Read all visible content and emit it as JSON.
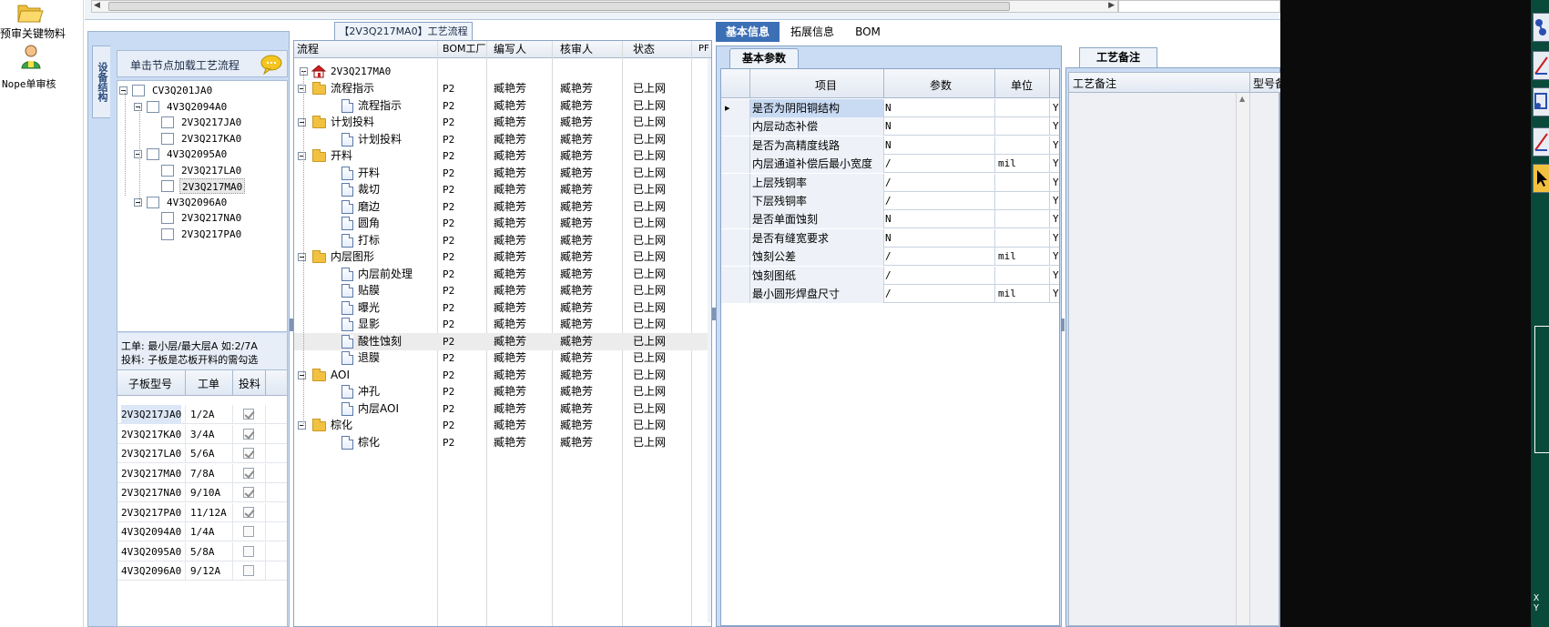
{
  "launcher": {
    "items": [
      {
        "icon": "folder-open-icon",
        "label": "预审关键物料"
      },
      {
        "icon": "user-review-icon",
        "label": "Nope单审核"
      }
    ]
  },
  "flow_title_tab": "【2V3Q217MA0】工艺流程",
  "left_panel": {
    "side_tab": "设备结构",
    "load_hint": "单击节点加载工艺流程",
    "tree": [
      {
        "label": "CV3Q201JA0",
        "level": 0,
        "expanded": true
      },
      {
        "label": "4V3Q2094A0",
        "level": 1,
        "expanded": true
      },
      {
        "label": "2V3Q217JA0",
        "level": 2
      },
      {
        "label": "2V3Q217KA0",
        "level": 2
      },
      {
        "label": "4V3Q2095A0",
        "level": 1,
        "expanded": true
      },
      {
        "label": "2V3Q217LA0",
        "level": 2
      },
      {
        "label": "2V3Q217MA0",
        "level": 2,
        "selected": true
      },
      {
        "label": "4V3Q2096A0",
        "level": 1,
        "expanded": true
      },
      {
        "label": "2V3Q217NA0",
        "level": 2
      },
      {
        "label": "2V3Q217PA0",
        "level": 2
      }
    ],
    "note_line1": "工单: 最小层/最大层A 如:2/7A",
    "note_line2": "投料: 子板是芯板开料的需勾选",
    "sub_table": {
      "headers": [
        "子板型号",
        "工单",
        "投料"
      ],
      "rows": [
        {
          "model": "2V3Q217JA0",
          "order": "1/2A",
          "feed": true
        },
        {
          "model": "2V3Q217KA0",
          "order": "3/4A",
          "feed": true
        },
        {
          "model": "2V3Q217LA0",
          "order": "5/6A",
          "feed": true
        },
        {
          "model": "2V3Q217MA0",
          "order": "7/8A",
          "feed": true
        },
        {
          "model": "2V3Q217NA0",
          "order": "9/10A",
          "feed": true
        },
        {
          "model": "2V3Q217PA0",
          "order": "11/12A",
          "feed": true
        },
        {
          "model": "4V3Q2094A0",
          "order": "1/4A",
          "feed": false
        },
        {
          "model": "4V3Q2095A0",
          "order": "5/8A",
          "feed": false
        },
        {
          "model": "4V3Q2096A0",
          "order": "9/12A",
          "feed": false
        }
      ]
    }
  },
  "flow_grid": {
    "headers": {
      "flow": "流程",
      "bom": "BOM工厂",
      "editor": "编写人",
      "reviewer": "核审人",
      "status": "状态",
      "extra": "PF"
    },
    "root_label": "2V3Q217MA0",
    "rows": [
      {
        "name": "流程指示",
        "kind": "folder",
        "bom": "P2",
        "editor": "臧艳芳",
        "reviewer": "臧艳芳",
        "status": "已上网"
      },
      {
        "name": "流程指示",
        "kind": "doc",
        "bom": "P2",
        "editor": "臧艳芳",
        "reviewer": "臧艳芳",
        "status": "已上网"
      },
      {
        "name": "计划投料",
        "kind": "folder",
        "bom": "P2",
        "editor": "臧艳芳",
        "reviewer": "臧艳芳",
        "status": "已上网"
      },
      {
        "name": "计划投料",
        "kind": "doc",
        "bom": "P2",
        "editor": "臧艳芳",
        "reviewer": "臧艳芳",
        "status": "已上网"
      },
      {
        "name": "开料",
        "kind": "folder",
        "bom": "P2",
        "editor": "臧艳芳",
        "reviewer": "臧艳芳",
        "status": "已上网"
      },
      {
        "name": "开料",
        "kind": "doc",
        "bom": "P2",
        "editor": "臧艳芳",
        "reviewer": "臧艳芳",
        "status": "已上网"
      },
      {
        "name": "裁切",
        "kind": "doc",
        "bom": "P2",
        "editor": "臧艳芳",
        "reviewer": "臧艳芳",
        "status": "已上网"
      },
      {
        "name": "磨边",
        "kind": "doc",
        "bom": "P2",
        "editor": "臧艳芳",
        "reviewer": "臧艳芳",
        "status": "已上网"
      },
      {
        "name": "圆角",
        "kind": "doc",
        "bom": "P2",
        "editor": "臧艳芳",
        "reviewer": "臧艳芳",
        "status": "已上网"
      },
      {
        "name": "打标",
        "kind": "doc",
        "bom": "P2",
        "editor": "臧艳芳",
        "reviewer": "臧艳芳",
        "status": "已上网"
      },
      {
        "name": "内层图形",
        "kind": "folder",
        "bom": "P2",
        "editor": "臧艳芳",
        "reviewer": "臧艳芳",
        "status": "已上网"
      },
      {
        "name": "内层前处理",
        "kind": "doc",
        "bom": "P2",
        "editor": "臧艳芳",
        "reviewer": "臧艳芳",
        "status": "已上网"
      },
      {
        "name": "贴膜",
        "kind": "doc",
        "bom": "P2",
        "editor": "臧艳芳",
        "reviewer": "臧艳芳",
        "status": "已上网"
      },
      {
        "name": "曝光",
        "kind": "doc",
        "bom": "P2",
        "editor": "臧艳芳",
        "reviewer": "臧艳芳",
        "status": "已上网"
      },
      {
        "name": "显影",
        "kind": "doc",
        "bom": "P2",
        "editor": "臧艳芳",
        "reviewer": "臧艳芳",
        "status": "已上网"
      },
      {
        "name": "酸性蚀刻",
        "kind": "doc",
        "bom": "P2",
        "editor": "臧艳芳",
        "reviewer": "臧艳芳",
        "status": "已上网",
        "selected": true
      },
      {
        "name": "退膜",
        "kind": "doc",
        "bom": "P2",
        "editor": "臧艳芳",
        "reviewer": "臧艳芳",
        "status": "已上网"
      },
      {
        "name": "AOI",
        "kind": "folder",
        "bom": "P2",
        "editor": "臧艳芳",
        "reviewer": "臧艳芳",
        "status": "已上网"
      },
      {
        "name": "冲孔",
        "kind": "doc",
        "bom": "P2",
        "editor": "臧艳芳",
        "reviewer": "臧艳芳",
        "status": "已上网"
      },
      {
        "name": "内层AOI",
        "kind": "doc",
        "bom": "P2",
        "editor": "臧艳芳",
        "reviewer": "臧艳芳",
        "status": "已上网"
      },
      {
        "name": "棕化",
        "kind": "folder",
        "bom": "P2",
        "editor": "臧艳芳",
        "reviewer": "臧艳芳",
        "status": "已上网"
      },
      {
        "name": "棕化",
        "kind": "doc",
        "bom": "P2",
        "editor": "臧艳芳",
        "reviewer": "臧艳芳",
        "status": "已上网"
      }
    ]
  },
  "detail": {
    "tabs": [
      "基本信息",
      "拓展信息",
      "BOM"
    ],
    "active_tab": 0,
    "subtab": "基本参数",
    "param_headers": {
      "item": "项目",
      "param": "参数",
      "unit": "单位"
    },
    "params": [
      {
        "item": "是否为阴阳铜结构",
        "value": "N",
        "unit": "",
        "flag": "Y"
      },
      {
        "item": "内层动态补偿",
        "value": "N",
        "unit": "",
        "flag": "Y"
      },
      {
        "item": "是否为高精度线路",
        "value": "N",
        "unit": "",
        "flag": "Y"
      },
      {
        "item": "内层通道补偿后最小宽度",
        "value": "/",
        "unit": "mil",
        "flag": "Y"
      },
      {
        "item": "上层残铜率",
        "value": "/",
        "unit": "",
        "flag": "Y"
      },
      {
        "item": "下层残铜率",
        "value": "/",
        "unit": "",
        "flag": "Y"
      },
      {
        "item": "是否单面蚀刻",
        "value": "N",
        "unit": "",
        "flag": "Y"
      },
      {
        "item": "是否有缝宽要求",
        "value": "N",
        "unit": "",
        "flag": "Y"
      },
      {
        "item": "蚀刻公差",
        "value": "/",
        "unit": "mil",
        "flag": "Y"
      },
      {
        "item": "蚀刻图纸",
        "value": "/",
        "unit": "",
        "flag": "Y"
      },
      {
        "item": "最小圆形焊盘尺寸",
        "value": "/",
        "unit": "mil",
        "flag": "Y"
      }
    ]
  },
  "remarks": {
    "tab": "工艺备注",
    "col1": "工艺备注",
    "col2": "型号备"
  },
  "right_edge": {
    "tools": [
      "connector-icon",
      "line-icon",
      "node-icon",
      "line-icon",
      "pointer-icon"
    ],
    "bottom_text": "X Y"
  },
  "colors": {
    "accent_blue": "#3d6fb5",
    "panel_blue": "#c9dcf3",
    "home_red": "#d12020",
    "folder_yellow": "#f3c140",
    "dark_edge": "#0b0b0b"
  }
}
